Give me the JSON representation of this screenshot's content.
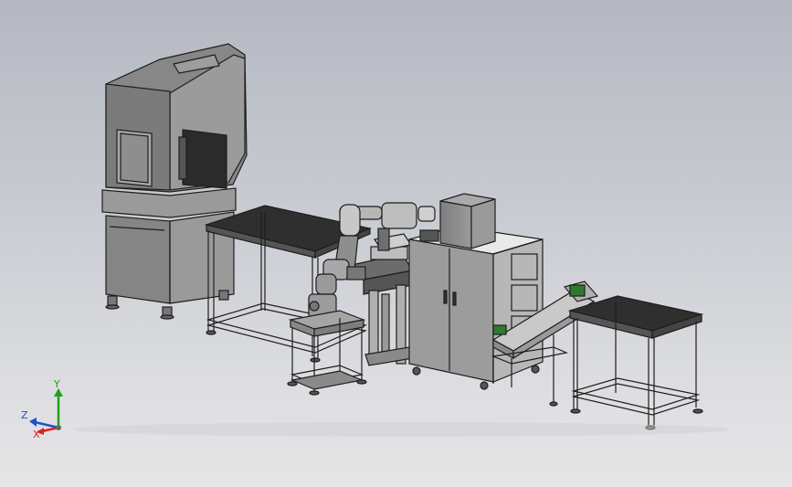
{
  "viewport": {
    "background_top": "#b4b8c1",
    "background_bottom": "#e6e6e7"
  },
  "triad": {
    "x_label": "X",
    "y_label": "Y",
    "z_label": "Z",
    "x_color": "#e02020",
    "y_color": "#1fa01f",
    "z_color": "#2050d0"
  },
  "model": {
    "parts": [
      "enclosure-machine",
      "work-table-left",
      "robot-arm",
      "robot-cart",
      "fixture-stand",
      "control-cabinet",
      "inspection-box",
      "conveyor",
      "work-table-right"
    ],
    "panel_color": "#8d8d8d",
    "edge_color": "#1e1e1e",
    "tabletop_color": "#2f2f2f",
    "accent_green": "#2f7a2f"
  }
}
